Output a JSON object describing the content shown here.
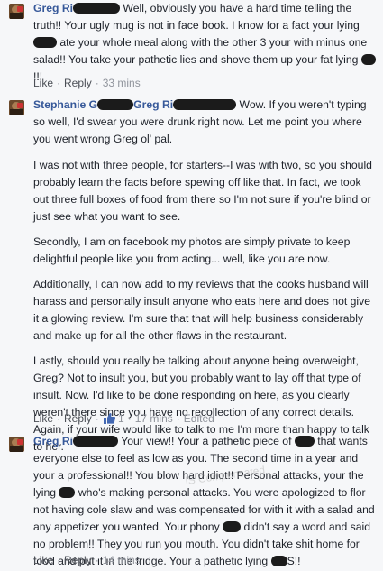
{
  "comments": [
    {
      "author": "Greg Ri",
      "avatar_icon": "profile-photo-icon",
      "paragraphs": [
        {
          "parts": [
            "Well, obviously you have a hard time telling the truth!! Your ugly mug is not in face book. I know for a fact your lying ",
            " ate your whole meal along with the other 3 your with minus one salad!! You take your pathetic lies and shove them up your fat lying ",
            "!!!"
          ]
        }
      ],
      "actions": {
        "like": "Like",
        "reply": "Reply",
        "time": "33 mins"
      }
    },
    {
      "author": "Stephanie G",
      "tag_name": "Greg Ri",
      "avatar_icon": "profile-photo-icon",
      "paragraphs": [
        {
          "parts": [
            "Wow. If you weren't typing so well, I'd swear you were drunk right now. Let me point you where you went wrong Greg ol' pal."
          ]
        },
        {
          "parts": [
            "I was not with three people, for starters--I was with two, so you should probably learn the facts before spewing off like that. In fact, we took out three full boxes of food from there so I'm not sure if you're blind or just see what you want to see."
          ]
        },
        {
          "parts": [
            "Secondly, I am on facebook my photos are simply private to keep delightful people like you from acting... well, like you are now."
          ]
        },
        {
          "parts": [
            "Additionally, I can now add to my reviews that the cooks husband will harass and personally insult anyone who eats here and does not give it a glowing review. I'm sure that that will help business considerably and make up for all the other flaws in the restaurant."
          ]
        },
        {
          "parts": [
            "Lastly, should you really be talking about anyone being overweight, Greg? Not to insult you, but you probably want to lay off that type of insult. Now. I'd like to be done responding on here, as you clearly weren't there since you have no recollection of any correct details. Again, if your wife would like to talk to me I'm more than happy to talk to her."
          ]
        }
      ],
      "actions": {
        "like": "Like",
        "reply": "Reply",
        "like_count": "1",
        "time": "17 mins",
        "edited": "Edited"
      }
    },
    {
      "author": "Greg Ri",
      "avatar_icon": "profile-photo-icon",
      "paragraphs": [
        {
          "parts": [
            "Your view!! Your a pathetic piece of ",
            " that wants everyone else to feel as low as you. The second time in a year and your a professional!! You blow hard idiot!! Personal attacks, your the lying ",
            " who's making personal attacks. You were apologized to flor not having cole slaw and was compensated for with it with a salad and any appetizer you wanted. Your phony ",
            " didn't say a word and said no problem!! They you run you mouth. You didn't take shit home for food and put it in the fridge. Your a pathetic lying ",
            "S!!"
          ]
        }
      ],
      "actions": {
        "like": "Like",
        "reply": "Reply",
        "time": "14 mins"
      }
    }
  ],
  "watermark": "IS Compensated",
  "colors": {
    "link": "#365899",
    "meta": "#90949c",
    "like_icon": "#4267b2"
  }
}
